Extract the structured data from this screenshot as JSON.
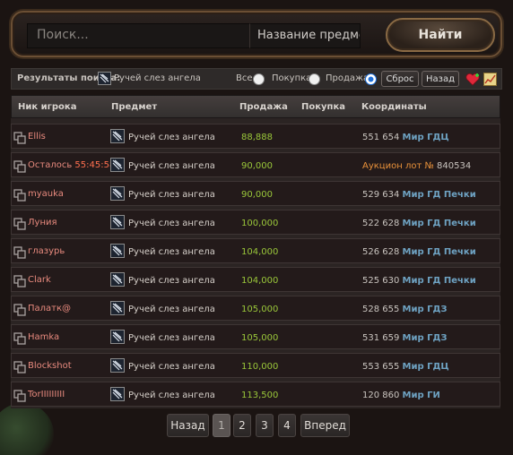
{
  "search": {
    "placeholder": "Поиск...",
    "item_field": "Название предмета",
    "find_label": "Найти"
  },
  "filter": {
    "results_label": "Результаты поиска:",
    "item_name": "Ручей слез ангела",
    "opt_all": "Все",
    "opt_buy": "Покупка",
    "opt_sell": "Продажа",
    "selected": "Продажа",
    "reset_label": "Сброс",
    "back_label": "Назад",
    "heart_icon": "heart-plus-icon",
    "chart_icon": "chart-icon"
  },
  "table": {
    "headers": {
      "nick": "Ник игрока",
      "item": "Предмет",
      "sell": "Продажа",
      "buy": "Покупка",
      "coords": "Координаты"
    },
    "rows": [
      {
        "nick": "Ellis",
        "item": "Ручей слез ангела",
        "price": "88,888",
        "xy": "551 654",
        "loc": "Мир ГДЦ"
      },
      {
        "nick": "Осталось",
        "timer": "55:45:58",
        "item": "Ручей слез ангела",
        "price": "90,000",
        "auction": "Аукцион лот №",
        "lot": "840534"
      },
      {
        "nick": "myauka",
        "item": "Ручей слез ангела",
        "price": "90,000",
        "xy": "529 634",
        "loc": "Мир ГД Печки"
      },
      {
        "nick": "Луния",
        "item": "Ручей слез ангела",
        "price": "100,000",
        "xy": "522 628",
        "loc": "Мир ГД Печки"
      },
      {
        "nick": "глазурь",
        "item": "Ручей слез ангела",
        "price": "104,000",
        "xy": "526 628",
        "loc": "Мир ГД Печки"
      },
      {
        "nick": "Clark",
        "item": "Ручей слез ангела",
        "price": "104,000",
        "xy": "525 630",
        "loc": "Мир ГД Печки"
      },
      {
        "nick": "Палатк@",
        "item": "Ручей слез ангела",
        "price": "105,000",
        "xy": "528 655",
        "loc": "Мир ГДЗ"
      },
      {
        "nick": "Hamka",
        "item": "Ручей слез ангела",
        "price": "105,000",
        "xy": "531 659",
        "loc": "Мир ГДЗ"
      },
      {
        "nick": "Blockshot",
        "item": "Ручей слез ангела",
        "price": "110,000",
        "xy": "553 655",
        "loc": "Мир ГДЦ"
      },
      {
        "nick": "TorIIIIIIIII",
        "item": "Ручей слез ангела",
        "price": "113,500",
        "xy": "120 860",
        "loc": "Мир ГИ"
      }
    ]
  },
  "pagination": {
    "prev": "Назад",
    "pages": [
      "1",
      "2",
      "3",
      "4"
    ],
    "current": "1",
    "next": "Вперед"
  },
  "colors": {
    "nick": "#e88a7e",
    "price": "#9ac73a",
    "location": "#6ea2c2",
    "auction": "#e8913a"
  }
}
